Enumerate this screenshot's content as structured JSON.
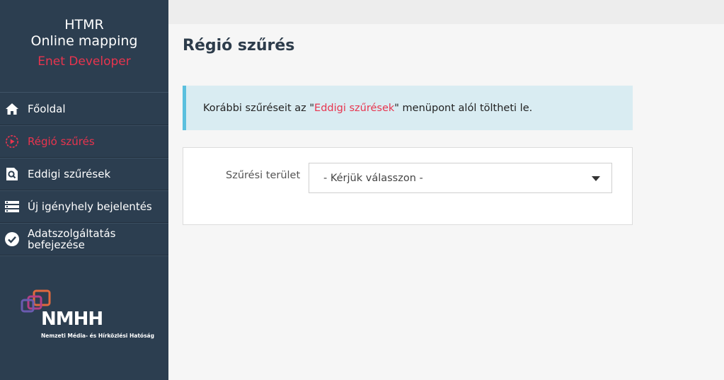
{
  "app": {
    "title_line1": "HTMR",
    "title_line2": "Online mapping",
    "subtitle": "Enet Developer"
  },
  "sidebar": {
    "items": [
      {
        "label": "Főoldal",
        "icon": "home-icon",
        "active": false
      },
      {
        "label": "Régió szűrés",
        "icon": "target-icon",
        "active": true
      },
      {
        "label": "Eddigi szűrések",
        "icon": "search-document-icon",
        "active": false
      },
      {
        "label": "Új igényhely bejelentés",
        "icon": "list-icon",
        "active": false
      },
      {
        "label": "Adatszolgáltatás befejezése",
        "icon": "check-circle-icon",
        "active": false
      }
    ],
    "logo": {
      "letters": "NMHH",
      "caption": "Nemzeti Média- és Hírközlési Hatóság"
    }
  },
  "main": {
    "page_title": "Régió szűrés",
    "alert": {
      "before": "Korábbi szűréseit az \"",
      "link": "Eddigi szűrések",
      "after": "\" menüpont alól töltheti le."
    },
    "form": {
      "field_label": "Szűrési terület",
      "select_value": "- Kérjük válasszon -"
    }
  },
  "colors": {
    "sidebar_bg": "#2c3e50",
    "accent": "#e8344e",
    "alert_bg": "#d9ecf2",
    "alert_border": "#5bc0de"
  }
}
